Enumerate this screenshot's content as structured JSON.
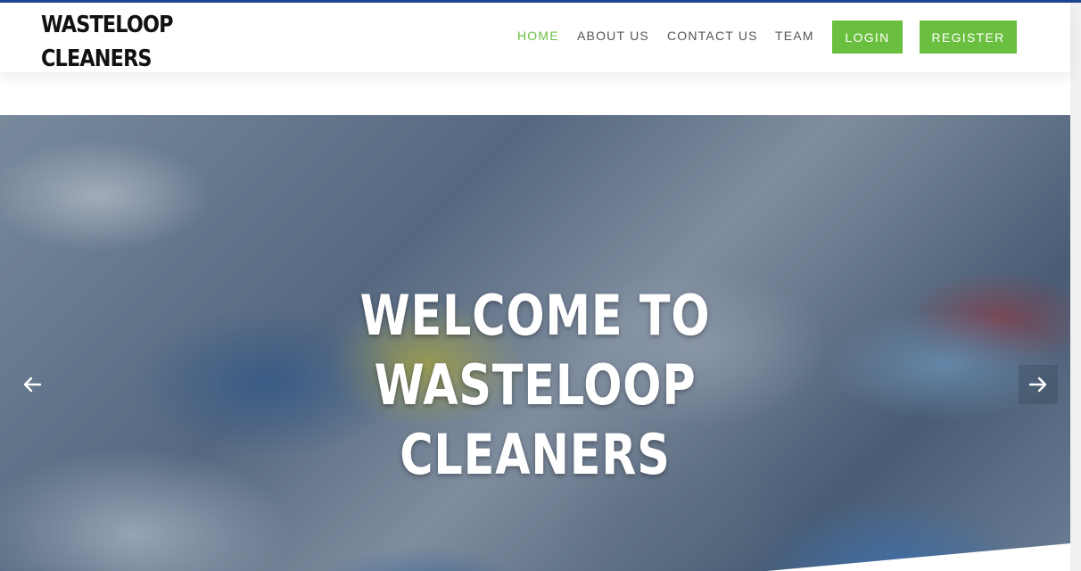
{
  "brand": {
    "line1": "WASTELOOP",
    "line2": "CLEANERS"
  },
  "nav": {
    "items": [
      {
        "label": "HOME",
        "active": true
      },
      {
        "label": "ABOUT US",
        "active": false
      },
      {
        "label": "CONTACT US",
        "active": false
      },
      {
        "label": "TEAM",
        "active": false
      }
    ],
    "login_label": "LOGIN",
    "register_label": "REGISTER"
  },
  "hero": {
    "title_lines": [
      "WELCOME TO",
      "WASTELOOP",
      "CLEANERS"
    ],
    "prev_icon": "arrow-left-icon",
    "next_icon": "arrow-right-icon"
  },
  "colors": {
    "accent": "#6bbf3f",
    "topbar": "#1c4690",
    "nav_text": "#555555"
  }
}
